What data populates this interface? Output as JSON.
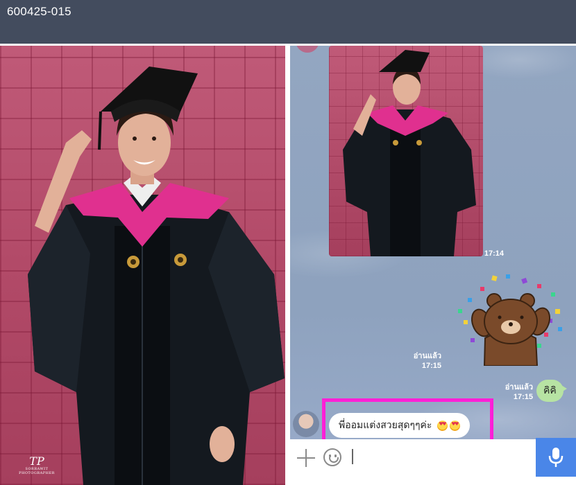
{
  "header": {
    "title": "600425-015"
  },
  "left_photo": {
    "watermark_text": "SORRAWIT PHOTOGRAPHER"
  },
  "chat": {
    "image_message": {
      "time": "17:14"
    },
    "sticker_message": {
      "read_label": "อ่านแล้ว",
      "time": "17:15"
    },
    "sent_text_message": {
      "read_label": "อ่านแล้ว",
      "time": "17:15",
      "text": "คิคิ"
    },
    "received_text_message": {
      "text": "พี่ออมแต่งสวยสุดๆๆค่ะ"
    },
    "input": {
      "placeholder": ""
    }
  },
  "colors": {
    "header_bg": "#434c5e",
    "chat_bg": "#93a6c1",
    "sent_bubble": "#b7e3a3",
    "highlight_border": "#ff1fd7",
    "mic_button": "#4a86e8"
  },
  "icons": [
    "plus-icon",
    "emoji-icon",
    "microphone-icon"
  ]
}
